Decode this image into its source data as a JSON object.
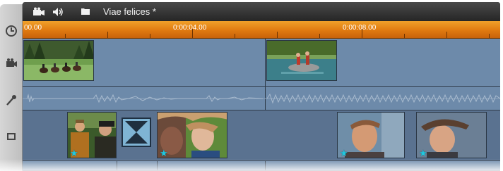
{
  "project": {
    "title": "Viae felices *"
  },
  "header_icons": [
    "camera-icon",
    "speaker-icon",
    "folder-icon"
  ],
  "sidebar_icons": [
    "clock-icon",
    "camera-icon",
    "microphone-icon",
    "film-icon"
  ],
  "ruler": {
    "labels": [
      "00.00",
      "0:00:04.00",
      "0:00:08.00"
    ]
  },
  "tracks": [
    {
      "name": "video-track-1",
      "clips": [
        "riders-on-horses",
        "rafting-boat"
      ]
    },
    {
      "name": "audio-track",
      "clips": [
        "audio-waveform-1",
        "audio-waveform-2"
      ]
    },
    {
      "name": "video-track-2",
      "clips": [
        "man-in-hat",
        "transition-hourglass",
        "woman-windy",
        "young-man",
        "boy-in-hat"
      ]
    }
  ],
  "colors": {
    "ruler": "#e07a10",
    "track": "#6d8aaa",
    "header": "#2e2e2e",
    "star": "#20c8e0"
  }
}
